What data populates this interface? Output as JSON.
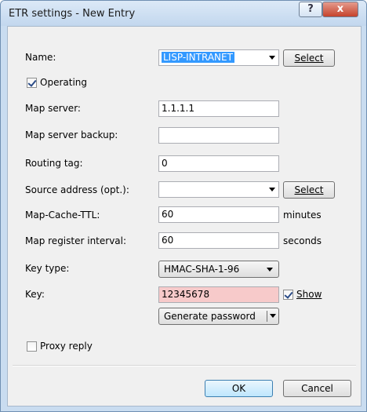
{
  "window": {
    "title": "ETR settings - New Entry",
    "help_label": "?",
    "close_label": "x"
  },
  "fields": {
    "name": {
      "label": "Name:",
      "value": "LISP-INTRANET",
      "select_label": "Select"
    },
    "operating": {
      "label": "Operating",
      "checked": true
    },
    "map_server": {
      "label": "Map server:",
      "value": "1.1.1.1"
    },
    "map_server_backup": {
      "label": "Map server backup:",
      "value": ""
    },
    "routing_tag": {
      "label": "Routing tag:",
      "value": "0"
    },
    "source_address": {
      "label": "Source address (opt.):",
      "value": "",
      "select_label": "Select"
    },
    "map_cache_ttl": {
      "label": "Map-Cache-TTL:",
      "value": "60",
      "unit": "minutes"
    },
    "map_register_interval": {
      "label": "Map register interval:",
      "value": "60",
      "unit": "seconds"
    },
    "key_type": {
      "label": "Key type:",
      "value": "HMAC-SHA-1-96"
    },
    "key": {
      "label": "Key:",
      "value": "12345678",
      "show_label": "Show",
      "show_checked": true,
      "generate_label": "Generate password"
    },
    "proxy_reply": {
      "label": "Proxy reply",
      "checked": false
    }
  },
  "buttons": {
    "ok": "OK",
    "cancel": "Cancel"
  },
  "colors": {
    "selection": "#3399ff",
    "key_background": "#f7caca"
  }
}
